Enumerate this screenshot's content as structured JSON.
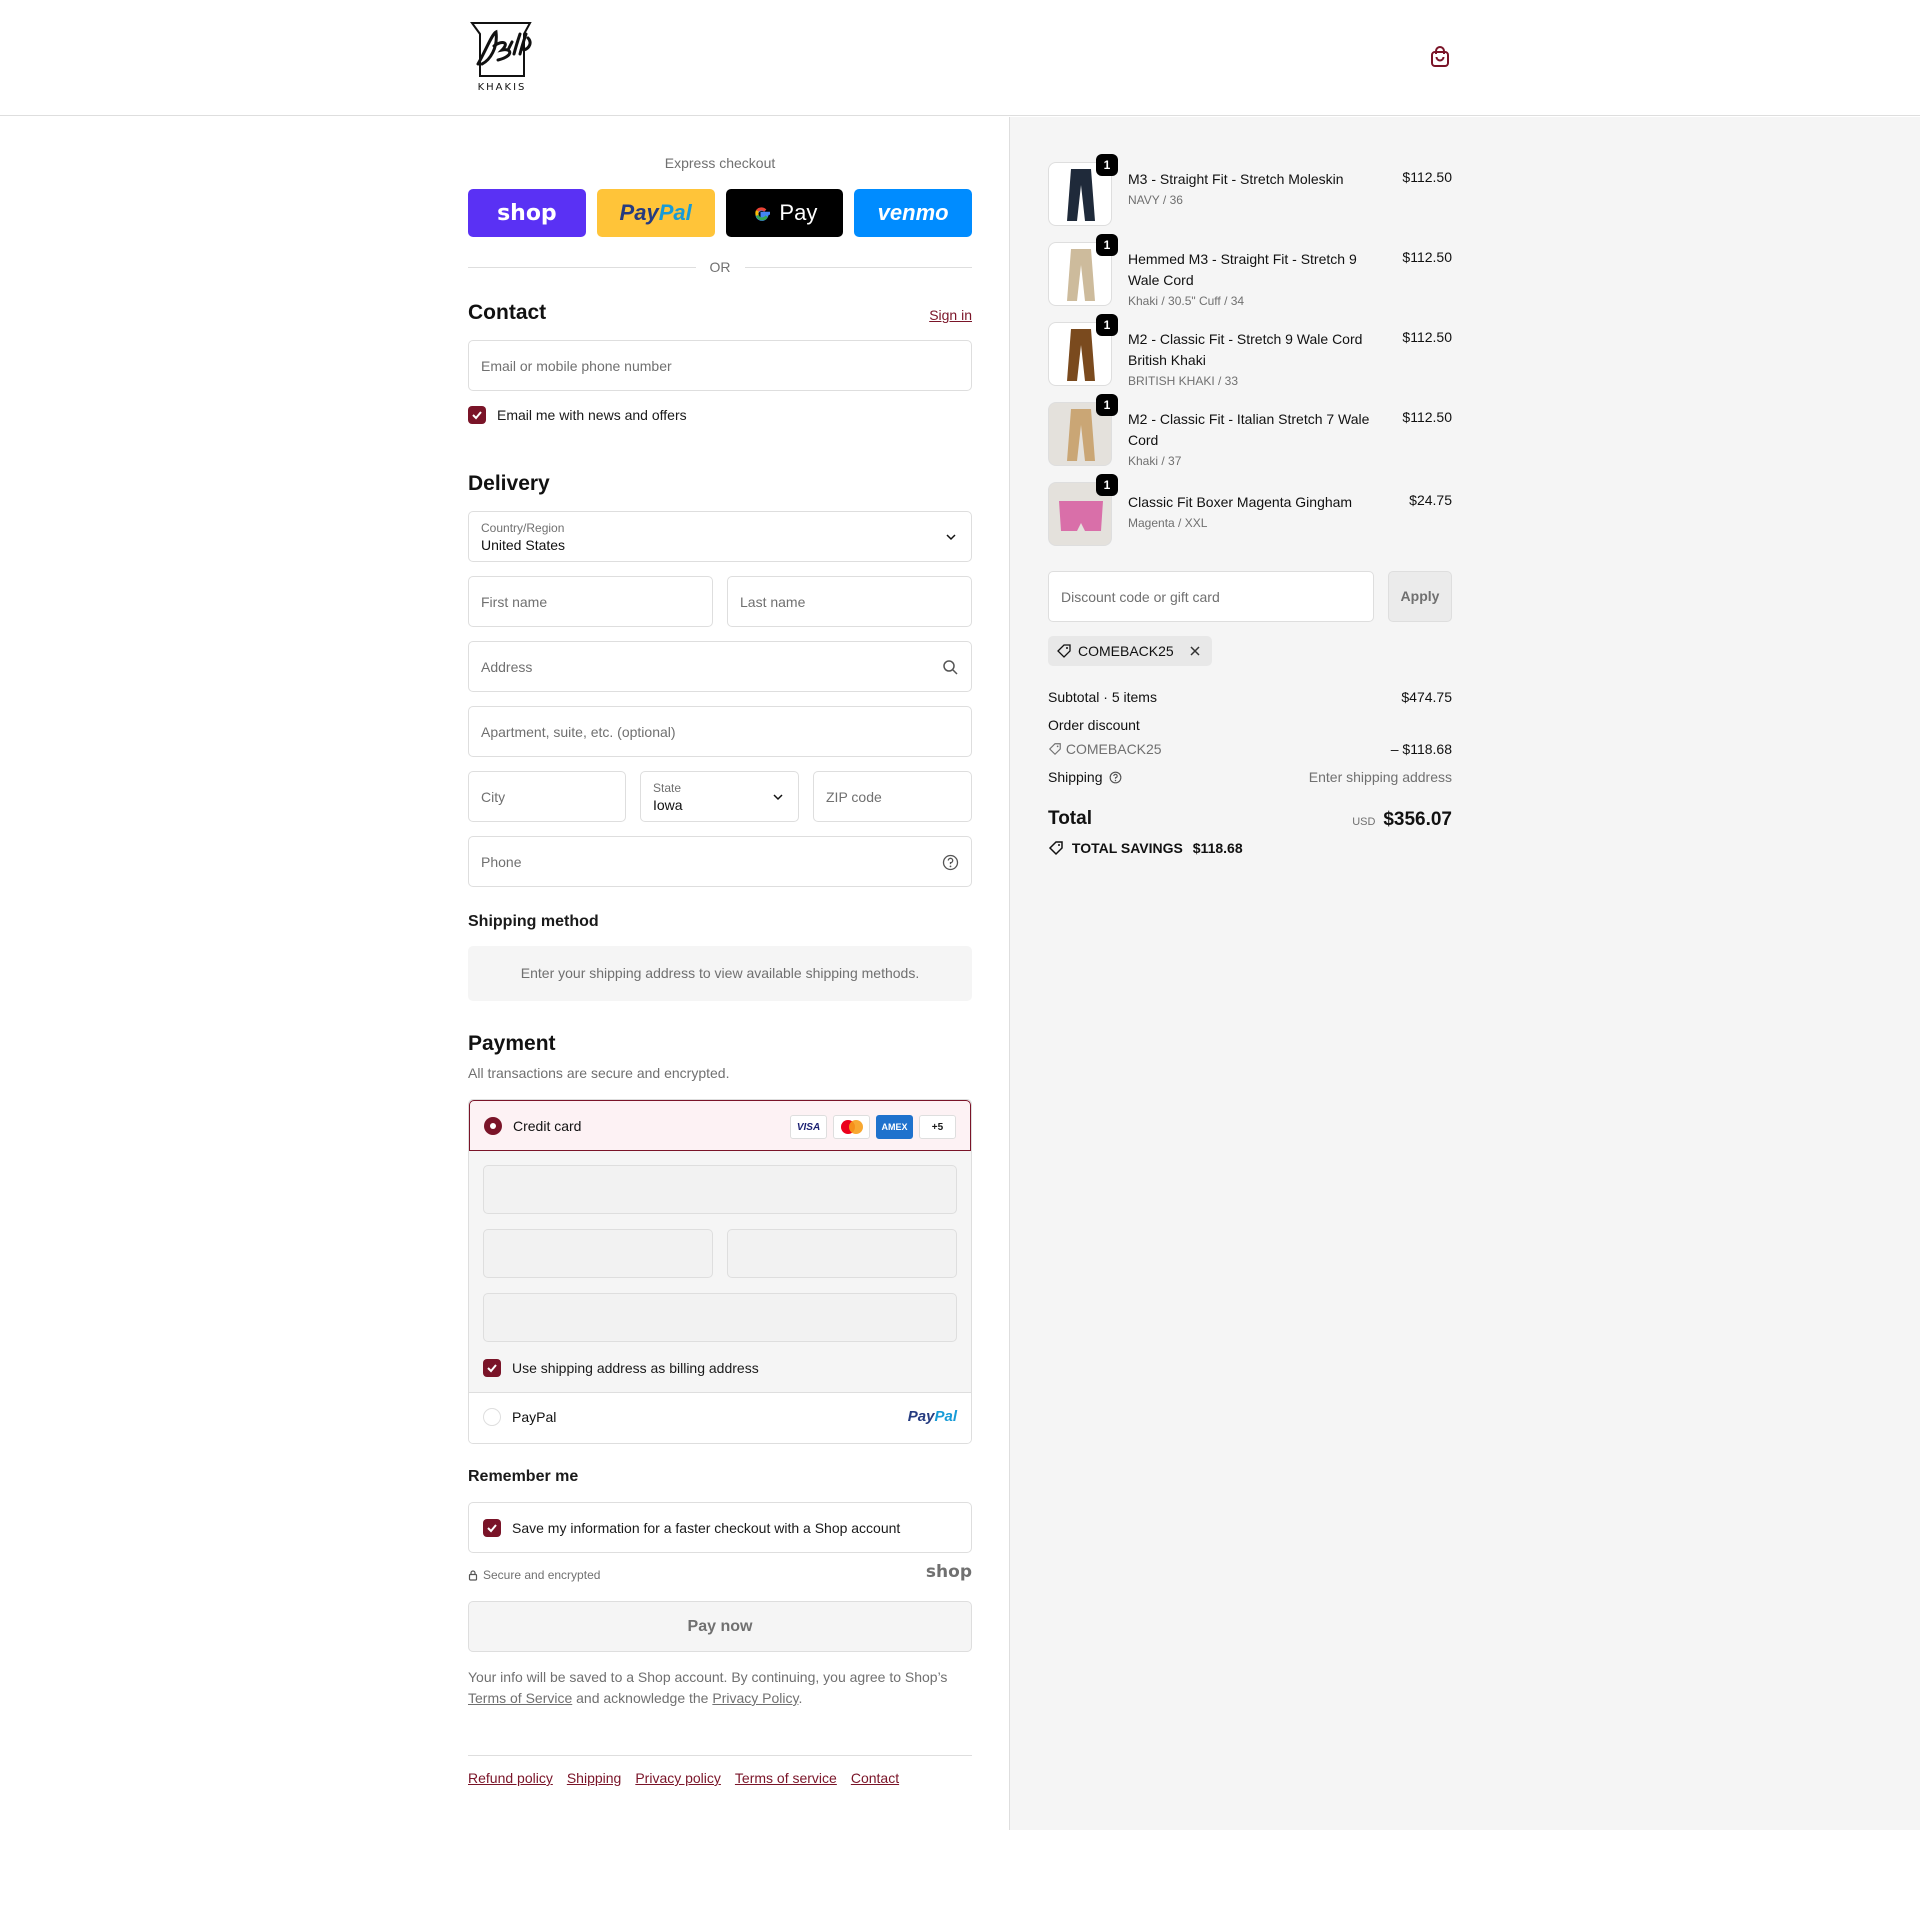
{
  "header": {
    "logo_text": "KHAKIS",
    "cart_icon": "shopping-bag-icon"
  },
  "express": {
    "title": "Express checkout",
    "buttons": {
      "shop": "shop",
      "paypal_a": "Pay",
      "paypal_b": "Pal",
      "gpay": "Pay",
      "venmo": "venmo"
    },
    "or": "OR"
  },
  "contact": {
    "title": "Contact",
    "sign_in": "Sign in",
    "email_placeholder": "Email or mobile phone number",
    "news_label": "Email me with news and offers"
  },
  "delivery": {
    "title": "Delivery",
    "country_label": "Country/Region",
    "country_value": "United States",
    "first_name": "First name",
    "last_name": "Last name",
    "address": "Address",
    "apartment": "Apartment, suite, etc. (optional)",
    "city": "City",
    "state_label": "State",
    "state_value": "Iowa",
    "zip": "ZIP code",
    "phone": "Phone"
  },
  "shipping_method": {
    "title": "Shipping method",
    "message": "Enter your shipping address to view available shipping methods."
  },
  "payment": {
    "title": "Payment",
    "subtitle": "All transactions are secure and encrypted.",
    "credit_card": "Credit card",
    "badges": [
      "VISA",
      "",
      "AMEX",
      "+5"
    ],
    "billing_label": "Use shipping address as billing address",
    "paypal": "PayPal",
    "paypal_logo_a": "Pay",
    "paypal_logo_b": "Pal"
  },
  "remember": {
    "title": "Remember me",
    "save_label": "Save my information for a faster checkout with a Shop account",
    "secure": "Secure and encrypted",
    "shop_logo": "shop"
  },
  "pay_now": "Pay now",
  "legal": {
    "text1": "Your info will be saved to a Shop account. By continuing, you agree to Shop’s",
    "tos": "Terms of Service",
    "text2": "and acknowledge the",
    "privacy": "Privacy Policy",
    "end": "."
  },
  "footer_links": [
    "Refund policy",
    "Shipping",
    "Privacy policy",
    "Terms of service",
    "Contact"
  ],
  "summary": {
    "items": [
      {
        "name": "M3 - Straight Fit - Stretch Moleskin",
        "variant": "NAVY / 36",
        "price": "$112.50",
        "qty": "1",
        "color": "#1f2a3a"
      },
      {
        "name": "Hemmed M3 - Straight Fit - Stretch 9 Wale Cord",
        "variant": "Khaki / 30.5\" Cuff / 34",
        "price": "$112.50",
        "qty": "1",
        "color": "#cdbb9c"
      },
      {
        "name": "M2 - Classic Fit - Stretch 9 Wale Cord British Khaki",
        "variant": "BRITISH KHAKI / 33",
        "price": "$112.50",
        "qty": "1",
        "color": "#7a4a1e"
      },
      {
        "name": "M2 - Classic Fit - Italian Stretch 7 Wale Cord",
        "variant": "Khaki / 37",
        "price": "$112.50",
        "qty": "1",
        "color": "#caa675"
      },
      {
        "name": "Classic Fit Boxer Magenta Gingham",
        "variant": "Magenta / XXL",
        "price": "$24.75",
        "qty": "1",
        "color": "#d96fa9"
      }
    ],
    "discount_placeholder": "Discount code or gift card",
    "apply": "Apply",
    "applied_code": "COMEBACK25",
    "subtotal_label": "Subtotal · 5 items",
    "subtotal_value": "$474.75",
    "order_discount_label": "Order discount",
    "discount_code": "COMEBACK25",
    "discount_value": "– $118.68",
    "shipping_label": "Shipping",
    "shipping_value": "Enter shipping address",
    "total_label": "Total",
    "currency": "USD",
    "total_value": "$356.07",
    "savings_label": "TOTAL SAVINGS",
    "savings_value": "$118.68"
  },
  "colors": {
    "accent": "#7a1428",
    "shop": "#5a31f4",
    "paypal": "#ffc439",
    "venmo": "#008cff"
  }
}
